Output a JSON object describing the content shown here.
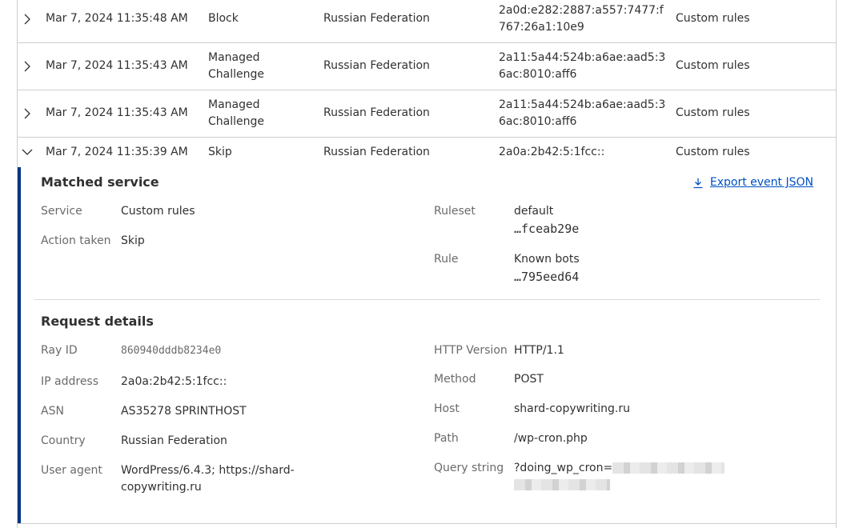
{
  "rows": [
    {
      "date": "Mar 7, 2024 11:35:48 AM",
      "action": "Block",
      "country": "Russian Federation",
      "ip": "2a0d:e282:2887:a557:7477:f767:26a1:10e9",
      "service": "Custom rules"
    },
    {
      "date": "Mar 7, 2024 11:35:43 AM",
      "action": "Managed Challenge",
      "country": "Russian Federation",
      "ip": "2a11:5a44:524b:a6ae:aad5:36ac:8010:aff6",
      "service": "Custom rules"
    },
    {
      "date": "Mar 7, 2024 11:35:43 AM",
      "action": "Managed Challenge",
      "country": "Russian Federation",
      "ip": "2a11:5a44:524b:a6ae:aad5:36ac:8010:aff6",
      "service": "Custom rules"
    },
    {
      "date": "Mar 7, 2024 11:35:39 AM",
      "action": "Skip",
      "country": "Russian Federation",
      "ip": "2a0a:2b42:5:1fcc::",
      "service": "Custom rules"
    }
  ],
  "detail": {
    "matched_title": "Matched service",
    "export_label": "Export event JSON",
    "service_label": "Service",
    "service_value": "Custom rules",
    "action_label": "Action taken",
    "action_value": "Skip",
    "ruleset_label": "Ruleset",
    "ruleset_name": "default",
    "ruleset_id": "…fceab29e",
    "rule_label": "Rule",
    "rule_name": "Known bots",
    "rule_id": "…795eed64",
    "request_title": "Request details",
    "ray_label": "Ray ID",
    "ray_value": "860940dddb8234e0",
    "ip_label": "IP address",
    "ip_value": "2a0a:2b42:5:1fcc::",
    "asn_label": "ASN",
    "asn_value": "AS35278 SPRINTHOST",
    "country_label": "Country",
    "country_value": "Russian Federation",
    "ua_label": "User agent",
    "ua_value": "WordPress/6.4.3; https://shard-copywriting.ru",
    "http_label": "HTTP Version",
    "http_value": "HTTP/1.1",
    "method_label": "Method",
    "method_value": "POST",
    "host_label": "Host",
    "host_value": "shard-copywriting.ru",
    "path_label": "Path",
    "path_value": "/wp-cron.php",
    "query_label": "Query string",
    "query_value": "?doing_wp_cron="
  },
  "colors": {
    "accent": "#003682",
    "link": "#0051c3"
  }
}
